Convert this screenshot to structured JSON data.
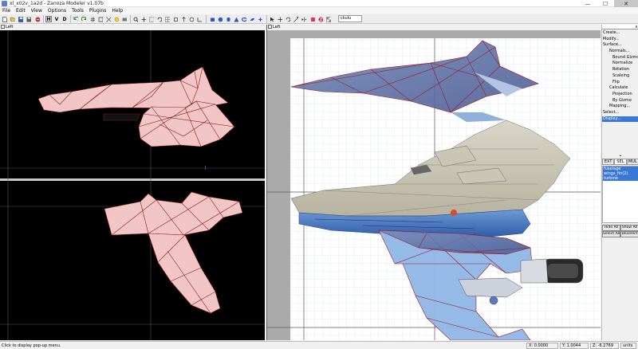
{
  "window": {
    "title": "xl_x02v_1a2d - Zanoza Modeler v1.07b",
    "minimize": "—",
    "maximize": "☐",
    "close": "✕"
  },
  "menu": [
    "File",
    "Edit",
    "View",
    "Options",
    "Tools",
    "Plugins",
    "Help"
  ],
  "toolbar": {
    "h_label": "H",
    "v_label": "V",
    "d_label": "D",
    "dropdown_value": "ckulu"
  },
  "panes": {
    "left_top_label": "Left",
    "right_label": "Left"
  },
  "sidebar": {
    "close_x": "x",
    "menu": [
      {
        "label": "Create...",
        "level": 0
      },
      {
        "label": "Modify...",
        "level": 0
      },
      {
        "label": "Surface...",
        "level": 0
      },
      {
        "label": "Normals...",
        "level": 1
      },
      {
        "label": "Bound Gizmo",
        "level": 2
      },
      {
        "label": "Normalize",
        "level": 2
      },
      {
        "label": "Rotation",
        "level": 2
      },
      {
        "label": "Scaleing",
        "level": 2
      },
      {
        "label": "Flip",
        "level": 2
      },
      {
        "label": "Calculate",
        "level": 1
      },
      {
        "label": "Projection",
        "level": 2
      },
      {
        "label": "By Gizmo",
        "level": 2
      },
      {
        "label": "Mapping...",
        "level": 1
      },
      {
        "label": "Select...",
        "level": 0
      },
      {
        "label": "Display...",
        "level": 0,
        "selected": true
      }
    ],
    "scroll_arrow": "⌄",
    "mode_tabs": [
      "EXT",
      "SEL",
      "MUL"
    ],
    "objects": [
      "fuselage",
      "wings_fin(2)",
      "turbine"
    ],
    "hide_all": "Hide All",
    "show_all": "Show All",
    "select_all": "Select All",
    "deselect": "Deselect"
  },
  "status": {
    "message": "Click to display pop-up menu.",
    "x_readout": "X: 0.0000",
    "y_readout": "Y: 1.0044",
    "z_readout": "Z: -6.2769",
    "units": "units"
  },
  "colors": {
    "wire_fill": "#f2c6c6",
    "wire_stroke": "#8b1a1a",
    "selection": "#3a78d6",
    "viewport_bg": "#000000",
    "grid_bg": "#aaaaaa"
  }
}
